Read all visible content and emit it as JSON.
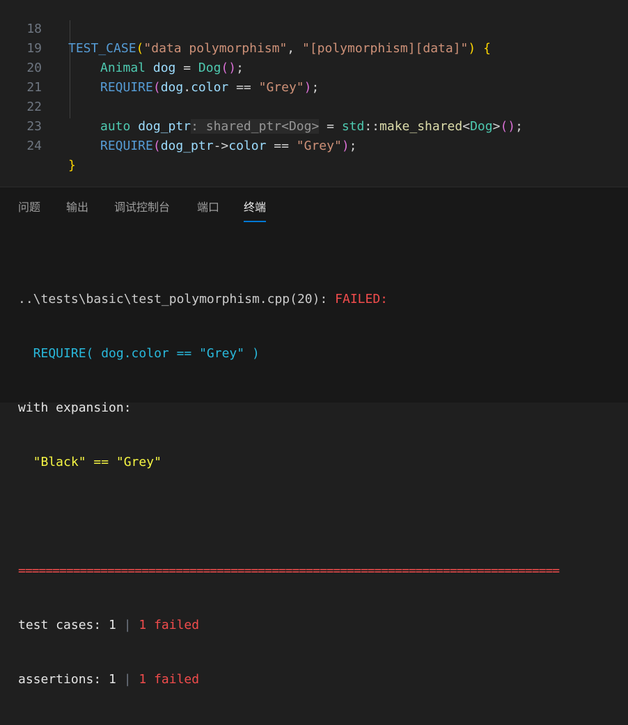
{
  "editor": {
    "lines": [
      {
        "num": "18",
        "parts": [
          "TEST_CASE",
          "(",
          "\"data polymorphism\"",
          ", ",
          "\"[polymorphism][data]\"",
          ") ",
          "{"
        ]
      },
      {
        "num": "19",
        "parts": [
          "Animal",
          " ",
          "dog",
          " = ",
          "Dog",
          "()",
          ";"
        ]
      },
      {
        "num": "20",
        "parts": [
          "REQUIRE",
          "(",
          "dog",
          ".",
          "color",
          " == ",
          "\"Grey\"",
          ")",
          ";"
        ]
      },
      {
        "num": "21",
        "parts": []
      },
      {
        "num": "22",
        "parts": [
          "auto",
          " ",
          "dog_ptr",
          ": shared_ptr<Dog>",
          " = ",
          "std",
          "::",
          "make_shared",
          "<",
          "Dog",
          ">",
          "()",
          ";"
        ]
      },
      {
        "num": "23",
        "parts": [
          "REQUIRE",
          "(",
          "dog_ptr",
          "->",
          "color",
          " == ",
          "\"Grey\"",
          ")",
          ";"
        ]
      },
      {
        "num": "24",
        "parts": [
          "}"
        ]
      }
    ]
  },
  "panel": {
    "tabs": [
      "问题",
      "输出",
      "调试控制台",
      "端口",
      "终端"
    ],
    "active_tab": "终端"
  },
  "terminal": {
    "path": "..\\tests\\basic\\test_polymorphism.cpp(20): ",
    "failed_label": "FAILED:",
    "require_expr": "  REQUIRE( dog.color == \"Grey\" )",
    "with_expansion": "with expansion:",
    "expansion": "  \"Black\" == \"Grey\"",
    "rule": "===============================================================================",
    "test_cases_label": "test cases: 1 ",
    "test_cases_sep": "|",
    "test_cases_failed": " 1 failed",
    "assertions_label": "assertions: 1 ",
    "assertions_sep": "|",
    "assertions_failed": " 1 failed"
  },
  "colors": {
    "background": "#1f1f1f",
    "panel_background": "#181818",
    "accent": "#0078d4",
    "error_red": "#f14c4c",
    "terminal_cyan": "#29b8db",
    "terminal_yellow": "#f5f543"
  }
}
